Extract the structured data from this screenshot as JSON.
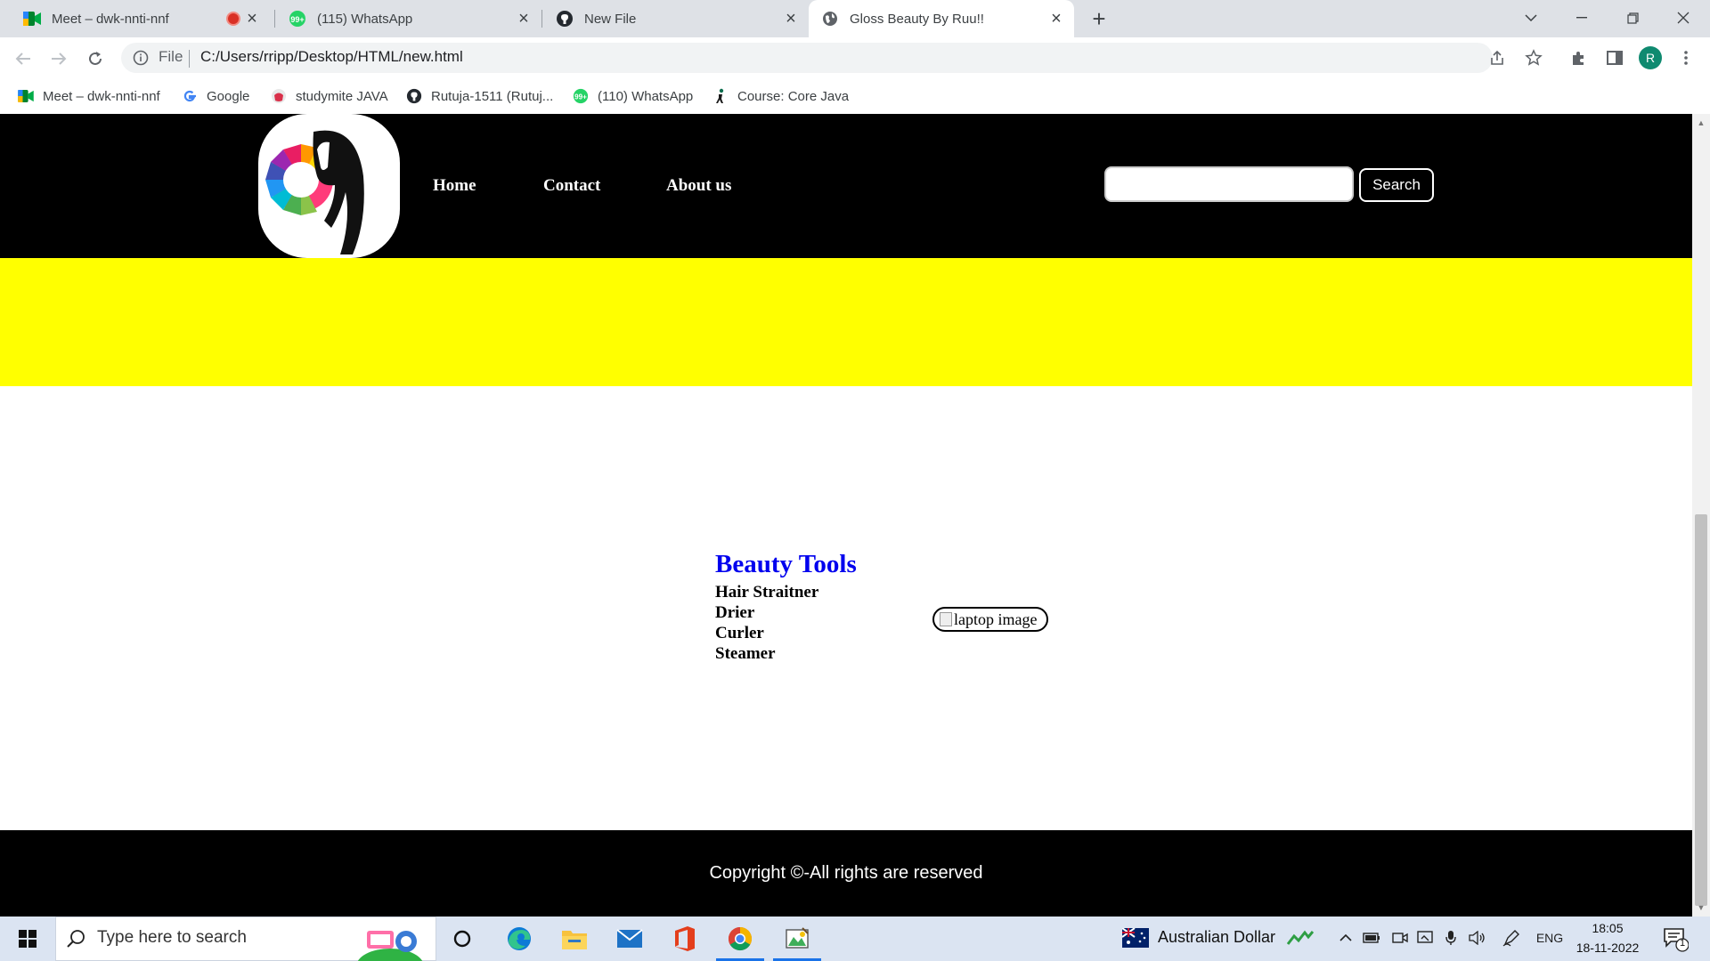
{
  "browser": {
    "tabs": [
      {
        "title": "Meet – dwk-nnti-nnf",
        "icon": "google-meet-icon",
        "recording": true
      },
      {
        "title": "(115) WhatsApp",
        "icon": "whatsapp-icon"
      },
      {
        "title": "New File",
        "icon": "github-icon"
      },
      {
        "title": "Gloss Beauty By Ruu!!",
        "icon": "globe-icon",
        "active": true
      }
    ],
    "omnibox": {
      "scheme_label": "File",
      "url": "C:/Users/rripp/Desktop/HTML/new.html"
    },
    "profile_initial": "R",
    "bookmarks": [
      {
        "label": "Meet – dwk-nnti-nnf",
        "icon": "google-meet-icon"
      },
      {
        "label": "Google",
        "icon": "google-icon"
      },
      {
        "label": "studymite JAVA",
        "icon": "studymite-icon"
      },
      {
        "label": "Rutuja-1511 (Rutuj...",
        "icon": "github-icon"
      },
      {
        "label": "(110) WhatsApp",
        "icon": "whatsapp-icon"
      },
      {
        "label": "Course: Core Java",
        "icon": "course-icon"
      }
    ]
  },
  "site": {
    "nav": [
      "Home",
      "Contact",
      "About us"
    ],
    "search": {
      "placeholder": "",
      "value": "",
      "button_label": "Search"
    },
    "banner_color": "#ffff00",
    "section": {
      "title": "Beauty Tools",
      "items": [
        "Hair Straitner",
        "Drier",
        "Curler",
        "Steamer"
      ],
      "image_alt": "laptop image"
    },
    "footer": "Copyright ©-All rights are reserved"
  },
  "taskbar": {
    "search_placeholder": "Type here to search",
    "apps": [
      "cortana-icon",
      "edge-icon",
      "file-explorer-icon",
      "mail-icon",
      "office-icon",
      "chrome-icon",
      "paint-icon"
    ],
    "tray": {
      "currency": "Australian Dollar",
      "language": "ENG",
      "time": "18:05",
      "date": "18-11-2022",
      "notifications": "1"
    }
  },
  "colors": {
    "accent_title": "#0000ee",
    "header_bg": "#000000",
    "chrome_tab_bg": "#dee1e6"
  }
}
